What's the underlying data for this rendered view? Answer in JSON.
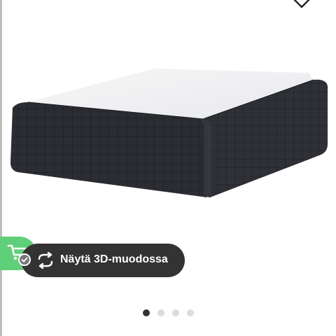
{
  "view3d": {
    "label": "Näytä 3D-muodossa"
  },
  "icons": {
    "wishlist": "heart-outline-icon",
    "cart": "shopping-cart-icon",
    "check": "checkmark-icon",
    "rotate": "rotate-3d-icon"
  },
  "carousel": {
    "total": 4,
    "active_index": 0
  },
  "colors": {
    "cart_fab": "#5fcf7a",
    "view3d_bg": "#333333",
    "dot_active": "#333333",
    "dot_inactive": "#dcdcdc"
  }
}
